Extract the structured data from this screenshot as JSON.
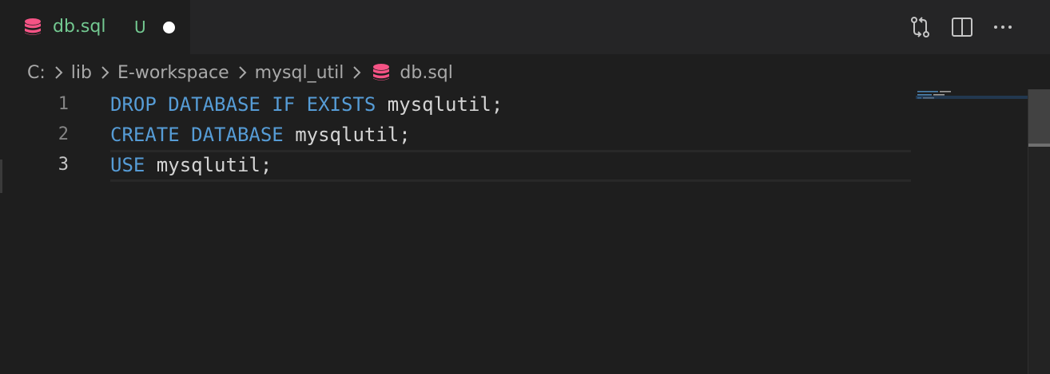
{
  "tab": {
    "label": "db.sql",
    "git_status": "U",
    "dirty": true,
    "icon": "database-icon",
    "label_color": "#73c991",
    "icon_color": "#f55385"
  },
  "actions": [
    {
      "name": "open-changes-button",
      "icon": "git-compare-icon"
    },
    {
      "name": "split-editor-button",
      "icon": "split-editor-icon"
    },
    {
      "name": "more-actions-button",
      "icon": "ellipsis-icon"
    }
  ],
  "breadcrumb": {
    "items": [
      "C:",
      "lib",
      "E-workspace",
      "mysql_util",
      "db.sql"
    ],
    "separator_icon": "chevron-right-icon"
  },
  "code": {
    "lines": [
      {
        "number": "1",
        "keyword": "DROP DATABASE IF EXISTS",
        "rest": " mysqlutil;"
      },
      {
        "number": "2",
        "keyword": "CREATE DATABASE",
        "rest": " mysqlutil;"
      },
      {
        "number": "3",
        "keyword": "USE",
        "rest": " mysqlutil;"
      }
    ],
    "active_line": 3,
    "keyword_color": "#569cd6",
    "text_color": "#d4d4d4"
  },
  "minimap": {
    "lines": [
      "DROP DATABASE IF EXISTS mysqlutil;",
      "CREATE DATABASE mysqlutil;",
      "USE mysqlutil;"
    ]
  }
}
